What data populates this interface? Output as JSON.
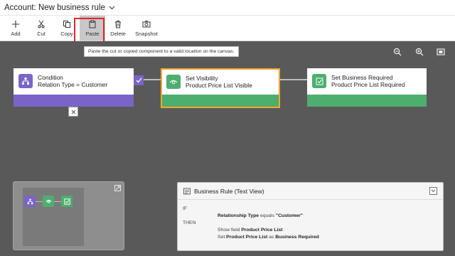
{
  "title": "Account: New business rule",
  "toolbar": {
    "add": "Add",
    "cut": "Cut",
    "copy": "Copy",
    "paste": "Paste",
    "delete": "Delete",
    "snapshot": "Snapshot"
  },
  "tooltip": "Paste the cut or copied component to a valid location on the canvas.",
  "nodes": {
    "condition": {
      "title": "Condition",
      "subtitle": "Relation Type = Customer",
      "color": "#7b64c8"
    },
    "set_visibility": {
      "title": "Set Visibility",
      "subtitle": "Product Price List Visible",
      "color": "#4dae6e"
    },
    "set_business_required": {
      "title": "Set Business Required",
      "subtitle": "Product Price List Required",
      "color": "#4dae6e"
    }
  },
  "colors": {
    "selected_border": "#f0a830",
    "highlight": "#e0262b",
    "canvas": "#595959"
  },
  "text_view": {
    "title": "Business Rule (Text View)",
    "if": "IF",
    "condition_field": "Relationship Type",
    "condition_op": "equals",
    "condition_value": "\"Customer\"",
    "then": "THEN",
    "action1_prefix": "Show field",
    "action1_field": "Product Price List",
    "action2_prefix": "Set",
    "action2_field": "Product Price List",
    "action2_mid": "as",
    "action2_value": "Business Required"
  }
}
